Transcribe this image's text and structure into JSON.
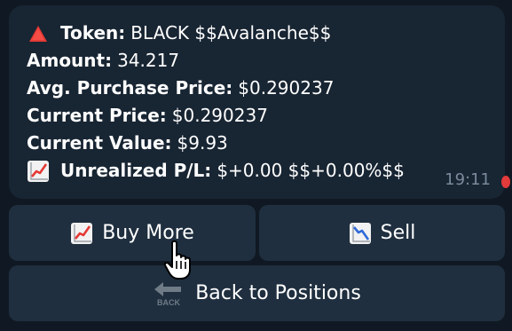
{
  "message": {
    "token": {
      "label": "Token:",
      "value": "BLACK $$Avalanche$$",
      "icon": "red-triangle-up-icon"
    },
    "amount": {
      "label": "Amount:",
      "value": "34.217"
    },
    "avg_purchase_price": {
      "label": "Avg. Purchase Price:",
      "value": "$0.290237"
    },
    "current_price": {
      "label": "Current Price:",
      "value": "$0.290237"
    },
    "current_value": {
      "label": "Current Value:",
      "value": "$9.93"
    },
    "unrealized_pl": {
      "label": "Unrealized P/L:",
      "value": "$+0.00 $$+0.00%$$",
      "icon": "chart-increasing-icon"
    },
    "time": "19:11"
  },
  "buttons": {
    "buy_more": {
      "label": "Buy More",
      "icon": "chart-increasing-icon"
    },
    "sell": {
      "label": "Sell",
      "icon": "chart-decreasing-icon"
    },
    "back": {
      "label": "Back to Positions",
      "icon": "back-arrow-icon"
    }
  },
  "colors": {
    "bubble": "#182533",
    "button": "#1f2f3f",
    "time": "#7b8b9b",
    "chart_up": "#e53935",
    "chart_down": "#2f6ad8"
  }
}
